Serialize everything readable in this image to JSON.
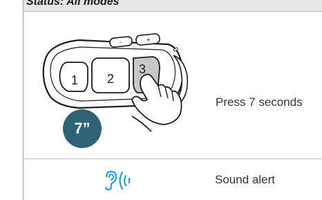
{
  "header": {
    "status_text": "Status: All modes"
  },
  "step": {
    "device_buttons": [
      "1",
      "2",
      "3"
    ],
    "volume_minus": "-",
    "volume_plus": "+",
    "duration_badge": "7”",
    "instruction": "Press 7 seconds"
  },
  "result": {
    "icon": "sound-alert-icon",
    "label": "Sound alert"
  },
  "colors": {
    "accent": "#2f6272",
    "sound_icon": "#1aa3e0",
    "header_bg": "#e6e6e6",
    "highlight_button": "#c8c8c8"
  }
}
